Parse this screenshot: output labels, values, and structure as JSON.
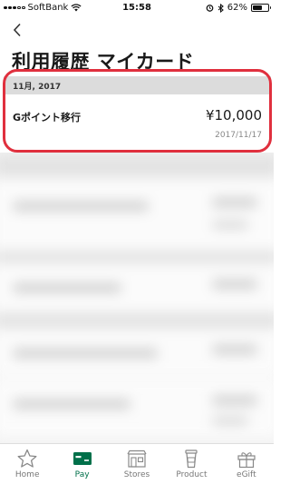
{
  "status_bar": {
    "carrier": "SoftBank",
    "time": "15:58",
    "battery_percent": "62%",
    "battery_level": 0.62
  },
  "header": {
    "title": "利用履歴 マイカード"
  },
  "history": {
    "section_label": "11月, 2017",
    "items": [
      {
        "name": "Gポイント移行",
        "amount": "¥10,000",
        "date": "2017/11/17"
      }
    ]
  },
  "tab_bar": {
    "items": [
      {
        "label": "Home",
        "icon": "star-icon",
        "active": false
      },
      {
        "label": "Pay",
        "icon": "card-icon",
        "active": true
      },
      {
        "label": "Stores",
        "icon": "store-icon",
        "active": false
      },
      {
        "label": "Product",
        "icon": "cup-icon",
        "active": false
      },
      {
        "label": "eGift",
        "icon": "gift-icon",
        "active": false
      }
    ]
  },
  "colors": {
    "accent": "#00704a",
    "highlight": "#e0303e",
    "section_bg": "#dcdcdc"
  }
}
